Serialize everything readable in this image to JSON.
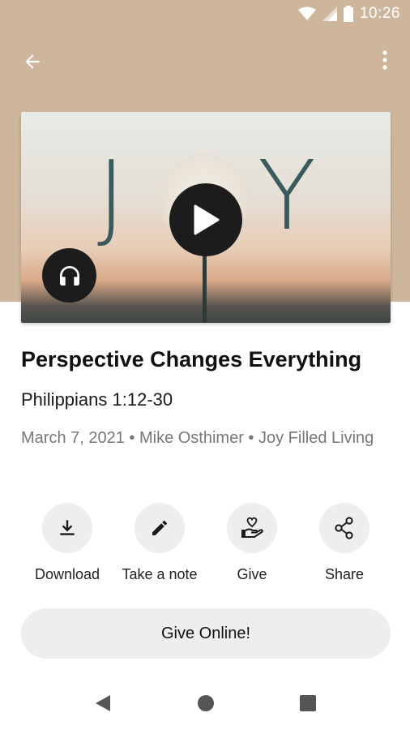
{
  "status_bar": {
    "time": "10:26"
  },
  "header": {
    "back_icon": "arrow-back-icon",
    "more_icon": "more-vertical-icon"
  },
  "artwork": {
    "word_left": "J",
    "word_right": "Y",
    "play_icon": "play-icon",
    "audio_icon": "headphones-icon"
  },
  "sermon": {
    "title": "Perspective Changes Everything",
    "scripture": "Philippians 1:12-30",
    "meta": "March 7, 2021 • Mike Osthimer • Joy Filled Living"
  },
  "actions": [
    {
      "label": "Download",
      "icon": "download-icon"
    },
    {
      "label": "Take a note",
      "icon": "pencil-icon"
    },
    {
      "label": "Give",
      "icon": "give-hand-heart-icon"
    },
    {
      "label": "Share",
      "icon": "share-icon"
    }
  ],
  "give_button": {
    "label": "Give Online!"
  },
  "colors": {
    "header_bg": "#cdb69c",
    "button_bg": "#eeeeee",
    "dark_circle": "#1c1c1c",
    "meta_text": "#777777"
  }
}
